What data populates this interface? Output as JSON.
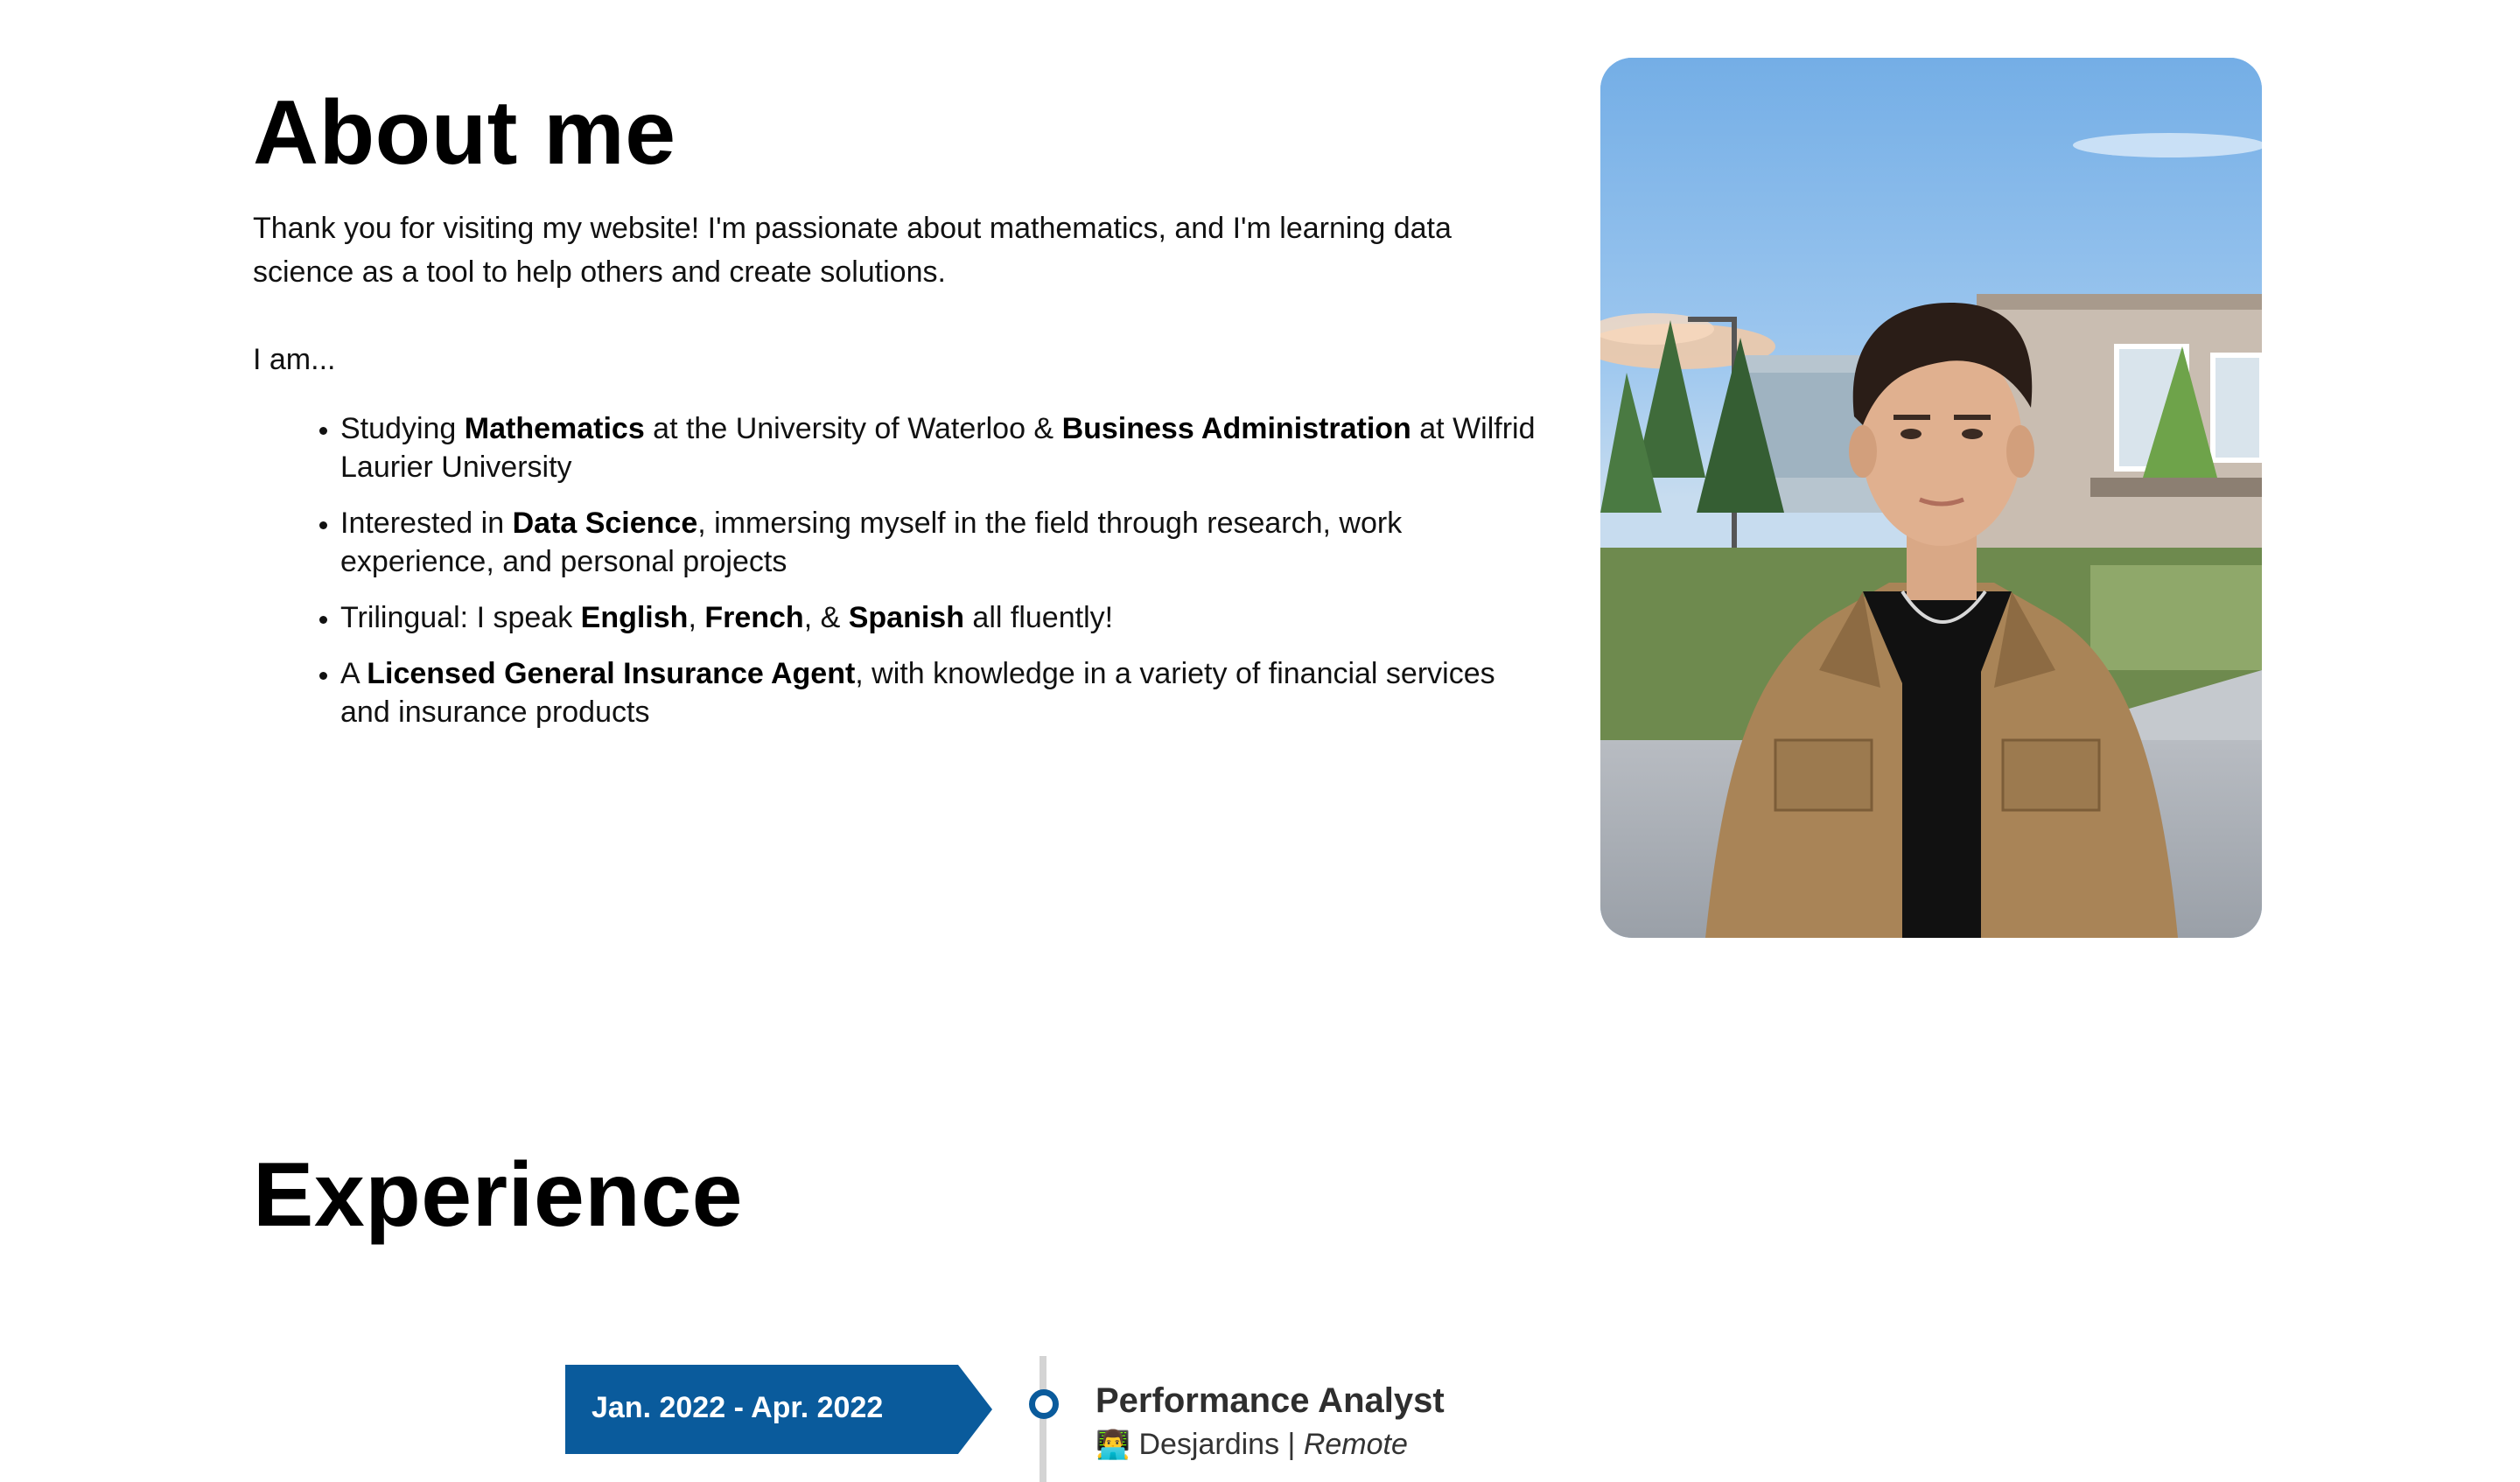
{
  "about": {
    "title": "About me",
    "intro": "Thank you for visiting my website! I'm passionate about mathematics, and I'm learning data science as a tool to help others and create solutions.",
    "iam": "I am...",
    "facts": [
      {
        "t1": "Studying ",
        "b1": "Mathematics",
        "t2": " at the University of Waterloo & ",
        "b2": "Business Administration",
        "t3": " at Wilfrid Laurier University"
      },
      {
        "t1": "Interested in ",
        "b1": "Data Science",
        "t2": ", immersing myself in the field through research, work experience, and personal projects"
      },
      {
        "t1": "Trilingual: I speak ",
        "b1": "English",
        "t2": ", ",
        "b2": "French",
        "t3": ", & ",
        "b3": "Spanish",
        "t4": " all fluently!"
      },
      {
        "t1": "A ",
        "b1": "Licensed General Insurance Agent",
        "t2": ", with knowledge in a variety of financial services and insurance products"
      }
    ]
  },
  "photo": {
    "icon": "portrait-photo"
  },
  "experience": {
    "title": "Experience",
    "items": [
      {
        "date": "Jan. 2022 - Apr. 2022",
        "role": "Performance Analyst",
        "emoji": "👨‍💻",
        "company": "Desjardins",
        "separator": " | ",
        "location": "Remote"
      }
    ]
  },
  "colors": {
    "accent": "#0a5b9c",
    "rail": "#d4d4d4",
    "text": "#111111"
  }
}
